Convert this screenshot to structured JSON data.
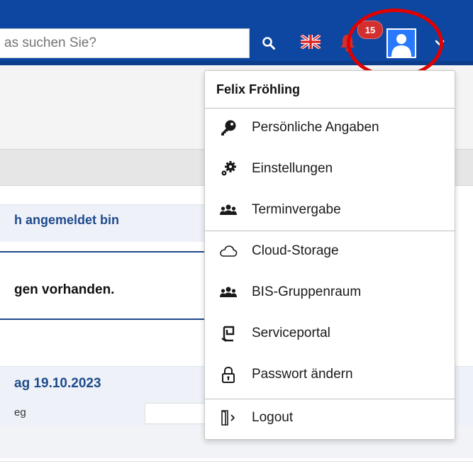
{
  "header": {
    "search_placeholder": "as suchen Sie?",
    "notification_count": "15",
    "accent_color": "#0d47a1",
    "badge_color": "#d32f2f"
  },
  "background": {
    "panel1_title": "h angemeldet bin",
    "panel1_text": "gen vorhanden.",
    "panel2_title": "ag 19.10.2023",
    "panel2_row_cell": "eg"
  },
  "user_menu": {
    "user_name": "Felix Fröhling",
    "items": [
      {
        "label": "Persönliche Angaben",
        "icon": "key-icon"
      },
      {
        "label": "Einstellungen",
        "icon": "gears-icon"
      },
      {
        "label": "Terminvergabe",
        "icon": "users-icon"
      },
      {
        "label": "Cloud-Storage",
        "icon": "cloud-icon"
      },
      {
        "label": "BIS-Gruppenraum",
        "icon": "users-icon"
      },
      {
        "label": "Serviceportal",
        "icon": "serviceportal-icon"
      },
      {
        "label": "Passwort ändern",
        "icon": "lock-icon"
      },
      {
        "label": "Logout",
        "icon": "logout-icon"
      }
    ]
  }
}
